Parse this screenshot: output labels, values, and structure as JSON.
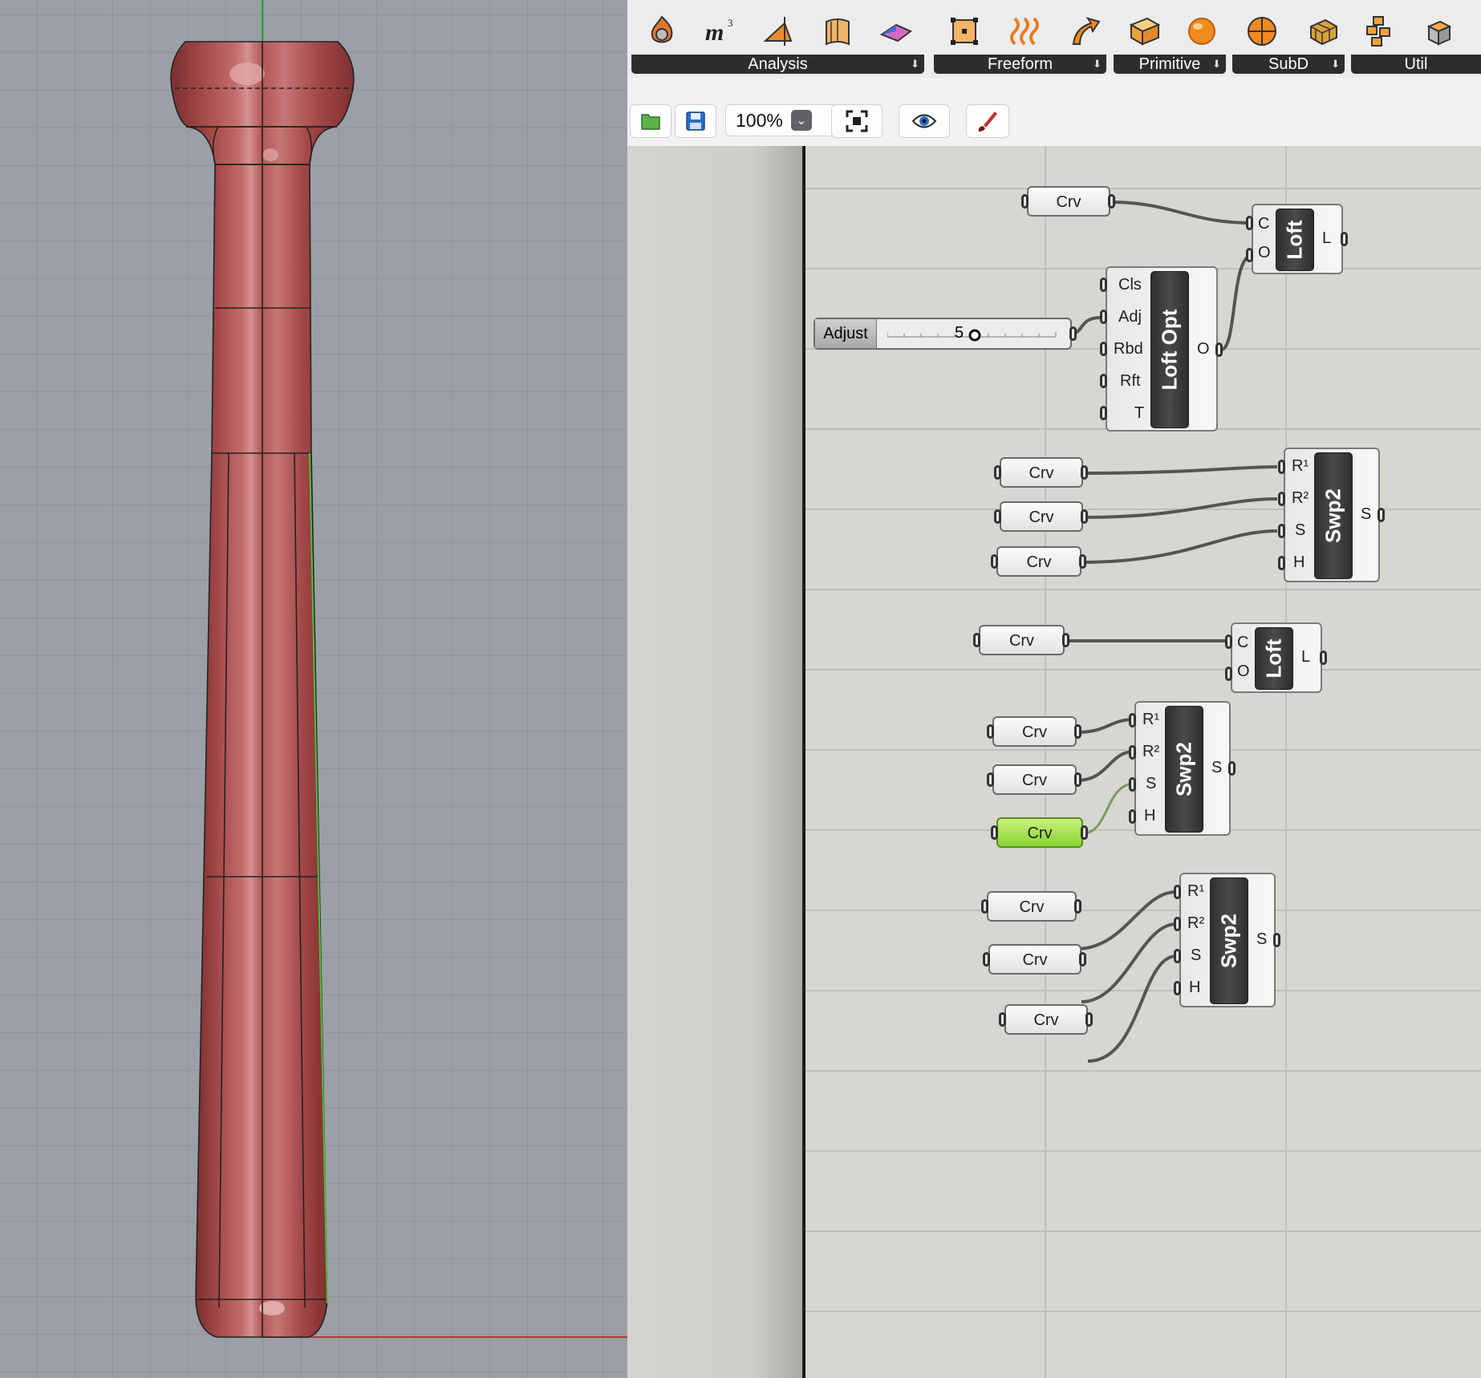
{
  "ribbon": {
    "groups": [
      {
        "label": "Analysis",
        "icons": [
          "fire-shield-icon",
          "volume-m3-icon",
          "orange-cone-icon",
          "orange-surface-icon",
          "pink-surface-icon"
        ]
      },
      {
        "label": "Freeform",
        "icons": [
          "control-point-grid-icon",
          "twisted-curves-icon",
          "orange-sweep-arrow-icon"
        ]
      },
      {
        "label": "Primitive",
        "icons": [
          "orange-box-icon",
          "orange-sphere-icon"
        ]
      },
      {
        "label": "SubD",
        "icons": [
          "subd-sphere-icon",
          "subd-mesh-box-icon"
        ]
      },
      {
        "label": "Util",
        "icons": [
          "util-grid-icon",
          "util-box-icon"
        ]
      }
    ]
  },
  "toolbar": {
    "zoom": "100%"
  },
  "canvas": {
    "crv_label": "Crv",
    "loft": {
      "title": "Loft",
      "inputs": [
        "C",
        "O"
      ],
      "output": "L"
    },
    "loft_opt": {
      "title": "Loft Opt",
      "inputs": [
        "Cls",
        "Adj",
        "Rbd",
        "Rft",
        "T"
      ],
      "output": "O"
    },
    "swp2": {
      "title": "Swp2",
      "inputs": [
        "R¹",
        "R²",
        "S",
        "H"
      ],
      "output": "S"
    },
    "slider": {
      "label": "Adjust",
      "value": "5"
    }
  },
  "colors": {
    "viewport_bg": "#9ba0a6",
    "model_red": "#a84c4c",
    "canvas_bg": "#d7d6d0",
    "ribbon_bar": "#2d2d2d",
    "selected_param": "#86d334"
  }
}
